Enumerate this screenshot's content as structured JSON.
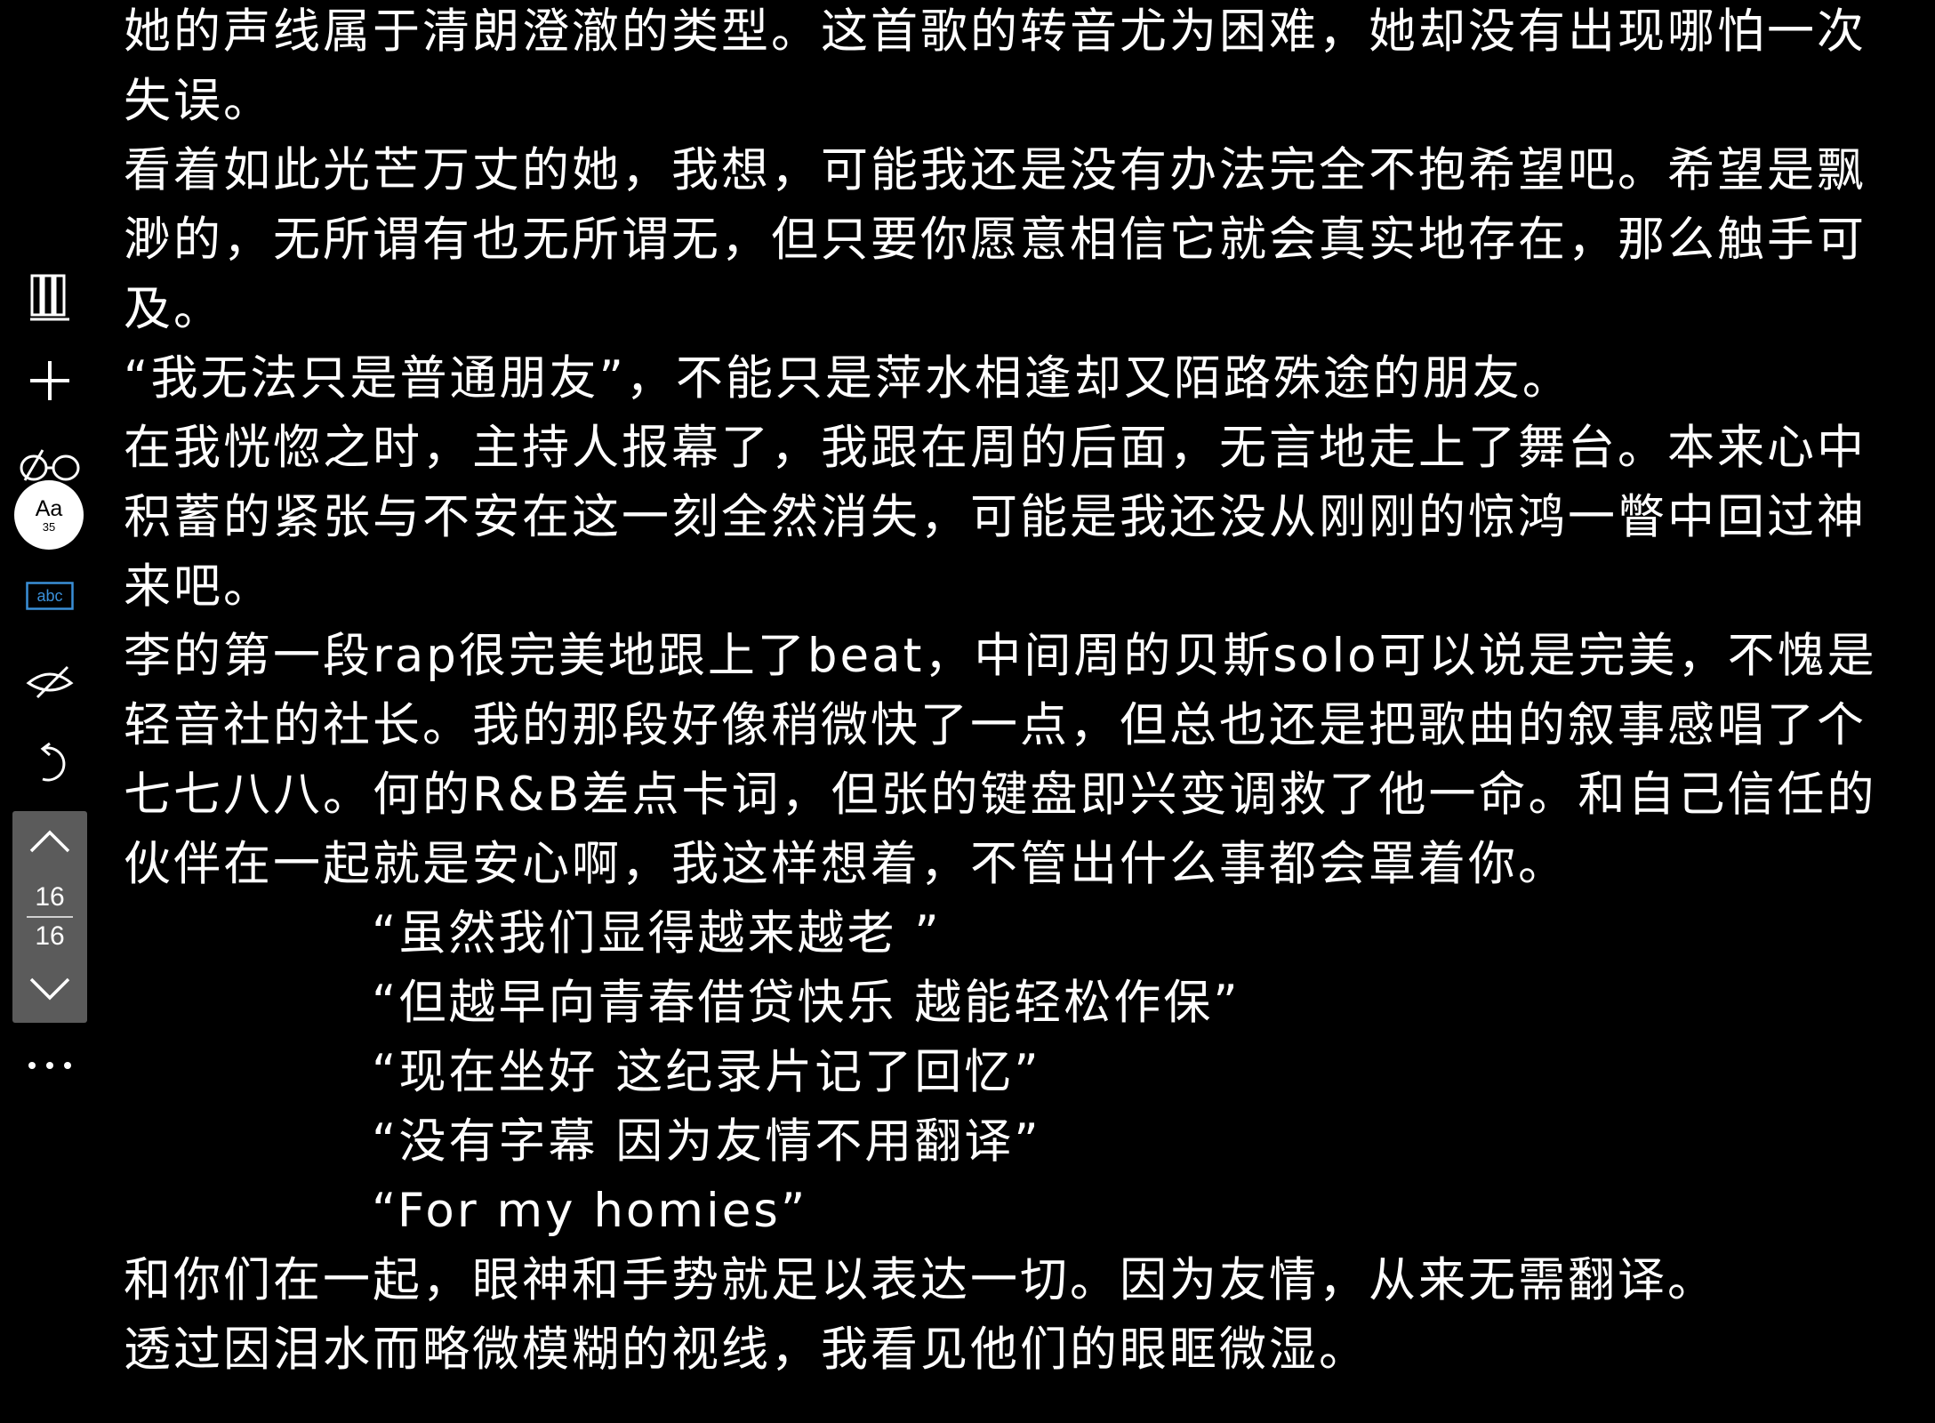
{
  "toolbar": {
    "library_icon": "bookshelf-icon",
    "add_icon": "plus-icon",
    "reading_icon": "glasses-icon",
    "font_badge": {
      "label": "Aa",
      "size": "35"
    },
    "dictionary_icon": "abc-dictionary-icon",
    "dictionary_label": "abc",
    "highlight_icon": "pen-eye-icon",
    "undo_icon": "undo-icon",
    "pager": {
      "current": "16",
      "total": "16"
    },
    "more_icon": "more-dots-icon"
  },
  "content": {
    "paragraphs_before": [
      "她的声线属于清朗澄澈的类型。这首歌的转音尤为困难，她却没有出现哪怕一次失误。",
      "看着如此光芒万丈的她，我想，可能我还是没有办法完全不抱希望吧。希望是飘渺的，无所谓有也无所谓无，但只要你愿意相信它就会真实地存在，那么触手可及。",
      "“我无法只是普通朋友”，不能只是萍水相逢却又陌路殊途的朋友。",
      "在我恍惚之时，主持人报幕了，我跟在周的后面，无言地走上了舞台。本来心中积蓄的紧张与不安在这一刻全然消失，可能是我还没从刚刚的惊鸿一瞥中回过神来吧。",
      "李的第一段rap很完美地跟上了beat，中间周的贝斯solo可以说是完美，不愧是轻音社的社长。我的那段好像稍微快了一点，但总也还是把歌曲的叙事感唱了个七七八八。何的R&B差点卡词，但张的键盘即兴变调救了他一命。和自己信任的伙伴在一起就是安心啊，我这样想着，不管出什么事都会罩着你。"
    ],
    "lyrics": [
      "“虽然我们显得越来越老 ”",
      "“但越早向青春借贷快乐 越能轻松作保”",
      "“现在坐好 这纪录片记了回忆”",
      "“没有字幕 因为友情不用翻译”",
      "“For my homies”"
    ],
    "paragraphs_after": [
      "和你们在一起，眼神和手势就足以表达一切。因为友情，从来无需翻译。",
      "透过因泪水而略微模糊的视线，我看见他们的眼眶微湿。"
    ]
  },
  "colors": {
    "background": "#000000",
    "text": "#ffffff",
    "pager_bg": "#5b5b5b",
    "dictionary_accent": "#3a8fd8"
  }
}
